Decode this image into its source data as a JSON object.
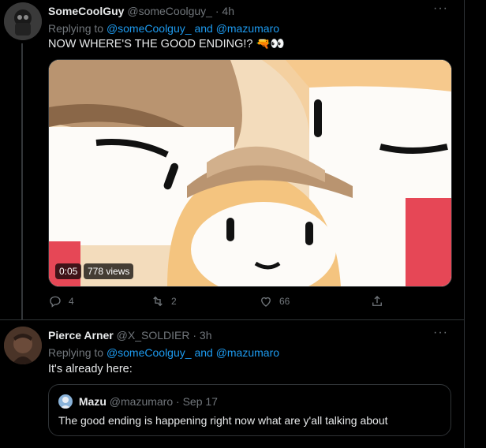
{
  "tweets": [
    {
      "name": "SomeCoolGuy",
      "handle": "@someCoolguy_",
      "time": "4h",
      "more": "···",
      "replying_prefix": "Replying to",
      "reply_to_1": "@someCoolguy_",
      "reply_and": "and",
      "reply_to_2": "@mazumaro",
      "text": "NOW WHERE'S THE GOOD ENDING!? 🔫👀",
      "video_time": "0:05",
      "video_views": "778 views",
      "replies": "4",
      "retweets": "2",
      "likes": "66"
    },
    {
      "name": "Pierce Arner",
      "handle": "@X_SOLDIER",
      "time": "3h",
      "more": "···",
      "replying_prefix": "Replying to",
      "reply_to_1": "@someCoolguy_",
      "reply_and": "and",
      "reply_to_2": "@mazumaro",
      "text": "It's already here:",
      "quote": {
        "name": "Mazu",
        "handle": "@mazumaro",
        "date": "Sep 17",
        "text": "The good ending is happening right now what are y'all talking about"
      }
    }
  ],
  "icons": {
    "reply": "reply-icon",
    "retweet": "retweet-icon",
    "like": "like-icon",
    "share": "share-icon",
    "more": "more-icon"
  },
  "colors": {
    "background": "#000000",
    "text": "#e7e9ea",
    "muted": "#71767b",
    "link": "#1d9bf0",
    "border": "#2f3336"
  }
}
